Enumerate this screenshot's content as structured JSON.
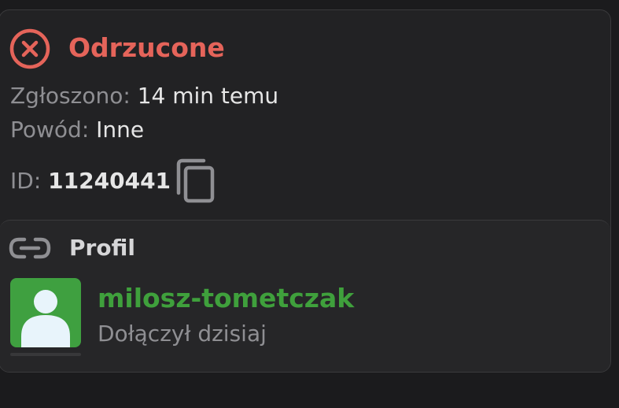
{
  "colors": {
    "background": "#1b1b1d",
    "card": "#222224",
    "rejected": "#e5645a",
    "username": "#3fa03c",
    "avatar_bg": "#3fa040",
    "muted": "#8f8f93"
  },
  "status": {
    "icon": "x-circle-icon",
    "title": "Odrzucone",
    "submitted_label": "Zgłoszono:",
    "submitted_value": "14 min temu",
    "reason_label": "Powód:",
    "reason_value": "Inne",
    "id_label": "ID:",
    "id_value": "11240441",
    "copy_icon": "copy-icon"
  },
  "profile": {
    "icon": "link-icon",
    "header": "Profil",
    "avatar_icon": "user-avatar-icon",
    "username": "milosz-tometczak",
    "joined": "Dołączył dzisiaj"
  }
}
